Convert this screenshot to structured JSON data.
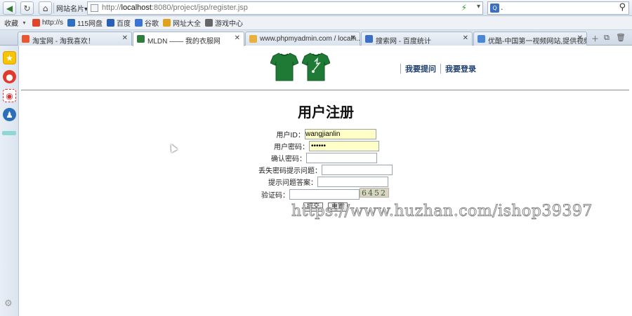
{
  "browser": {
    "site_dropdown": "网站名片",
    "url_prefix": "http://",
    "url_host": "localhost",
    "url_rest": ":8080/project/jsp/register.jsp",
    "search_value": "."
  },
  "bookmarks": [
    {
      "label": "收藏",
      "icon": "dropdown-icon",
      "color": "#777777"
    },
    {
      "label": "http://s",
      "icon": "taobao-icon",
      "color": "#e0452b"
    },
    {
      "label": "115网盘",
      "icon": "cloud-icon",
      "color": "#2f6fc0"
    },
    {
      "label": "百度",
      "icon": "baidu-icon",
      "color": "#2a5fb5"
    },
    {
      "label": "谷歌",
      "icon": "google-icon",
      "color": "#3b73d4"
    },
    {
      "label": "网址大全",
      "icon": "nav-icon",
      "color": "#e0a11f"
    },
    {
      "label": "游戏中心",
      "icon": "game-icon",
      "color": "#666666"
    }
  ],
  "tabs": [
    {
      "label": "淘宝网 - 淘我喜欢！",
      "color": "#e8572f",
      "active": false
    },
    {
      "label": "MLDN —— 我的衣服网",
      "color": "#2e7d3a",
      "active": true
    },
    {
      "label": "www.phpmyadmin.com / localh...",
      "color": "#e9b03c",
      "active": false
    },
    {
      "label": "搜索网 - 百度统计",
      "color": "#3a6fc4",
      "active": false
    },
    {
      "label": "优酷-中国第一视频网站,提供视频...",
      "color": "#4a86d6",
      "active": false
    }
  ],
  "page": {
    "links": [
      "我要提问",
      "我要登录"
    ],
    "title": "用户注册",
    "form": {
      "user_id_label": "用户ID：",
      "user_id_value": "wangjianlin",
      "password_label": "用户密码：",
      "password_value": "••••••",
      "confirm_label": "确认密码：",
      "question_label": "丢失密码提示问题：",
      "answer_label": "提示问题答案：",
      "captcha_label": "验证码：",
      "captcha_text": "6452",
      "submit_label": "提交",
      "reset_label": "重置"
    },
    "watermark": "https://www.huzhan.com/ishop39397"
  }
}
